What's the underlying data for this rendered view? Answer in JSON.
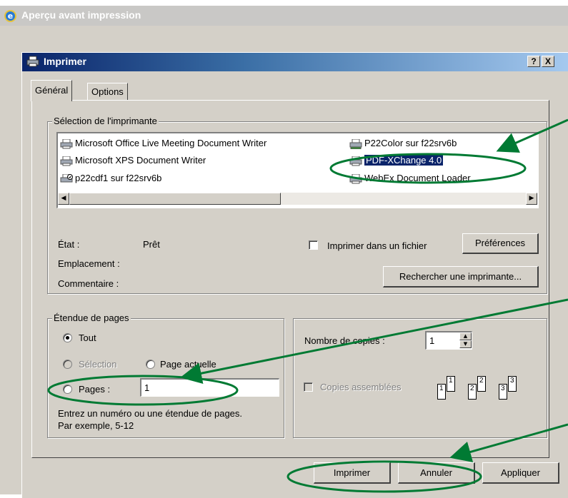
{
  "outer_window": {
    "title": "Aperçu avant impression"
  },
  "dialog": {
    "title": "Imprimer",
    "help_button": "?",
    "close_button": "X",
    "tabs": [
      {
        "label": "Général"
      },
      {
        "label": "Options"
      }
    ]
  },
  "printer_selection": {
    "legend": "Sélection de l'imprimante",
    "printers": [
      {
        "label": "Microsoft Office Live Meeting Document Writer",
        "icon": "printer-icon"
      },
      {
        "label": "P22Color sur f22srv6b",
        "icon": "network-printer-icon"
      },
      {
        "label": "Microsoft XPS Document Writer",
        "icon": "printer-icon"
      },
      {
        "label": "PDF-XChange 4.0",
        "icon": "printer-icon",
        "selected": true
      },
      {
        "label": "p22cdf1 sur f22srv6b",
        "icon": "default-network-printer-icon"
      },
      {
        "label": "WebEx Document Loader",
        "icon": "printer-icon"
      }
    ],
    "status_label": "État :",
    "status_value": "Prêt",
    "location_label": "Emplacement :",
    "comment_label": "Commentaire :",
    "print_to_file_label": "Imprimer dans un fichier",
    "preferences_button": "Préférences",
    "find_printer_button": "Rechercher une imprimante..."
  },
  "page_range": {
    "legend": "Étendue de pages",
    "all_label": "Tout",
    "selection_label": "Sélection",
    "current_page_label": "Page actuelle",
    "pages_label": "Pages :",
    "pages_value": "1",
    "help_line1": "Entrez un numéro ou une étendue de pages.",
    "help_line2": "Par exemple, 5-12"
  },
  "copies": {
    "copies_label": "Nombre de copies :",
    "copies_value": "1",
    "collate_label": "Copies assemblées",
    "collate_pages": [
      "1",
      "1",
      "2",
      "2",
      "3",
      "3"
    ]
  },
  "buttons": {
    "print": "Imprimer",
    "cancel": "Annuler",
    "apply": "Appliquer"
  },
  "colors": {
    "annotation": "#007a33",
    "selection": "#0a246a",
    "face": "#d4d0c8"
  }
}
